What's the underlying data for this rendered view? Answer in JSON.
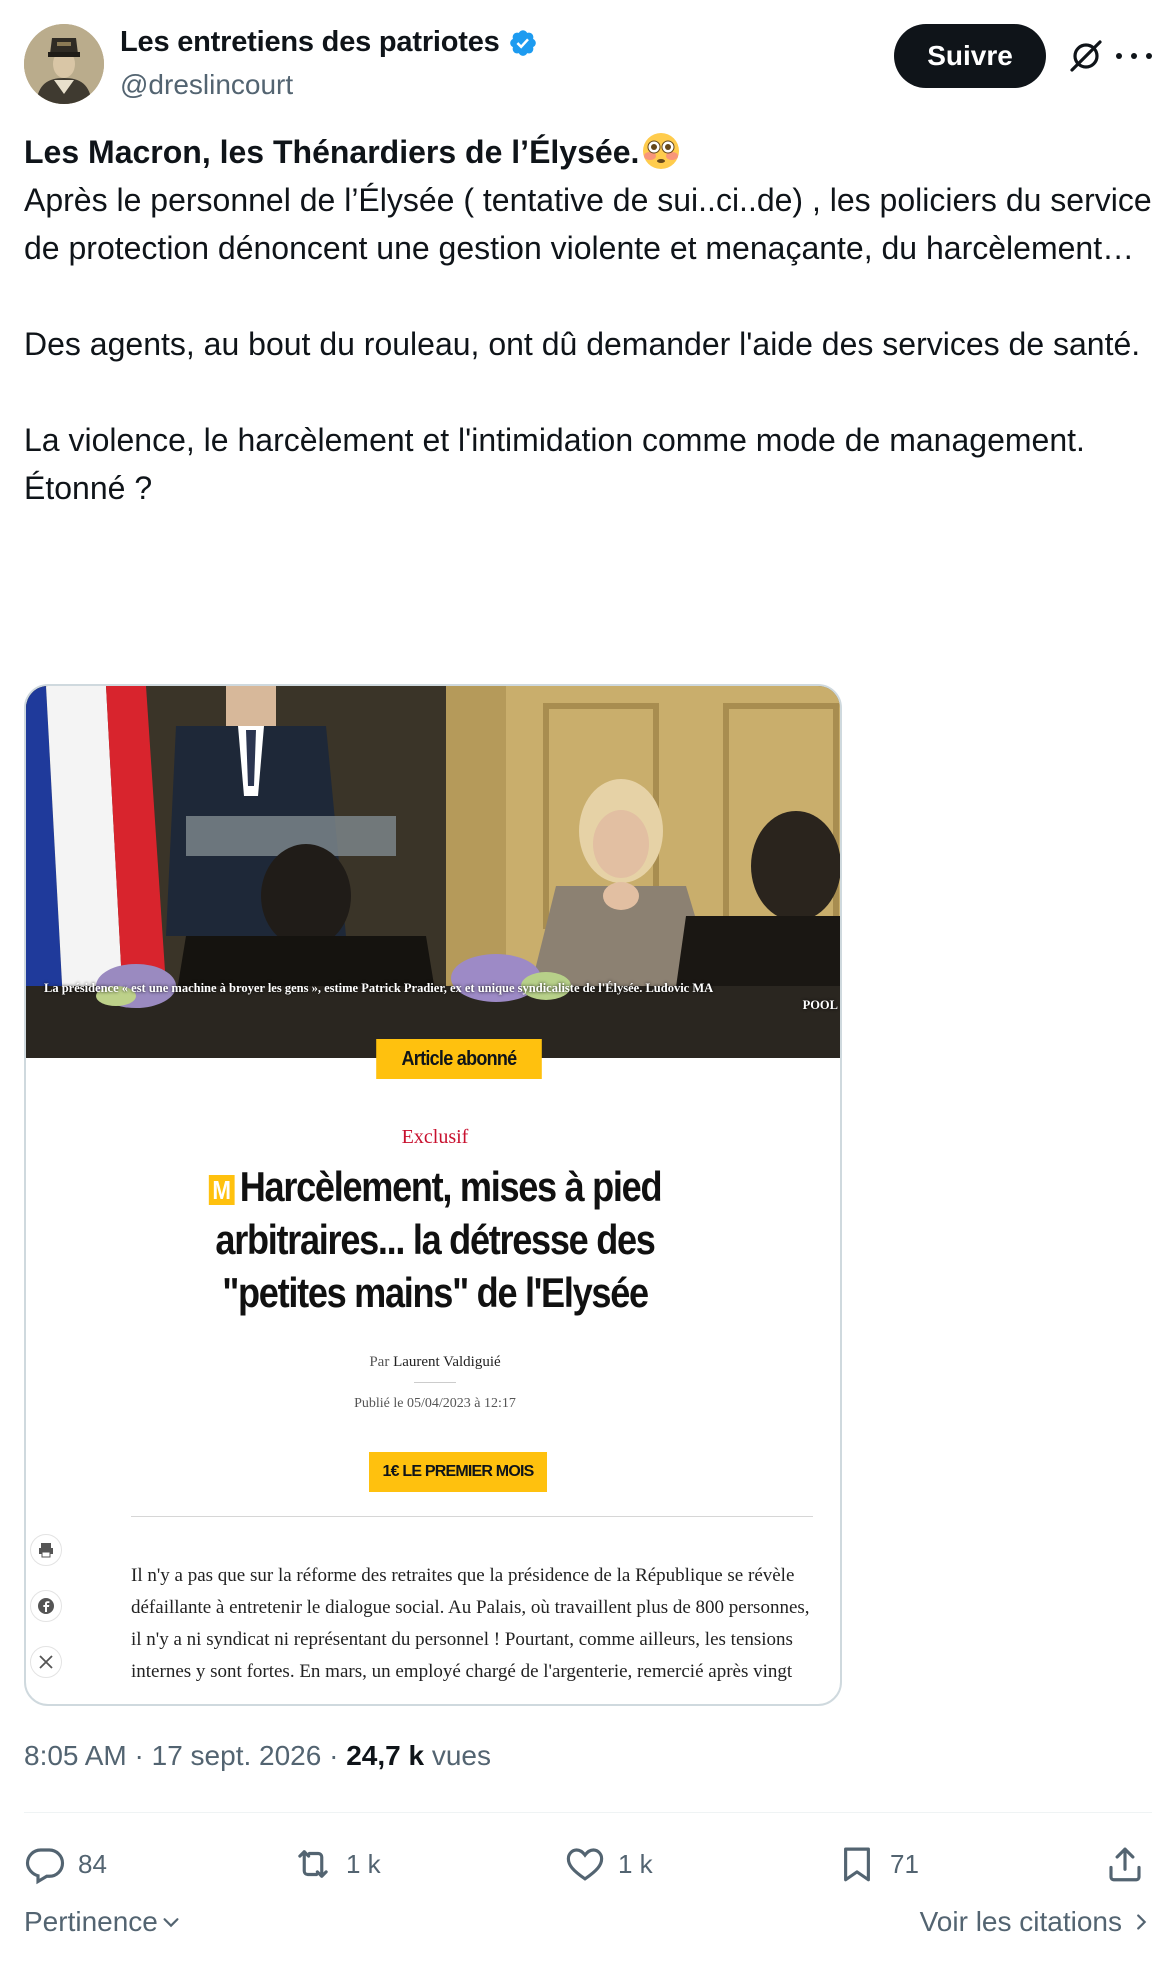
{
  "author": {
    "display_name": "Les entretiens des patriotes",
    "handle": "@dreslincourt",
    "verified_color": "#1d9bf0"
  },
  "header": {
    "follow_label": "Suivre"
  },
  "tweet": {
    "line1": "Les Macron, les Thénardiers de l’Élysée.",
    "line1_emoji": "flushed-face-emoji",
    "paragraph1": "Après le personnel de l’Élysée ( tentative de sui..ci..de) , les policiers du service de protection dénoncent une gestion violente et menaçante, du harcèlement…",
    "paragraph2": "Des agents, au bout du rouleau, ont dû demander l'aide des services de santé.",
    "paragraph3": "La violence, le harcèlement et l'intimidation comme mode de management.",
    "paragraph4": "Étonné ?"
  },
  "article_image": {
    "photo_caption_1": "La présidence « est une machine à broyer les gens », estime Patrick Pradier, ex et unique syndicaliste de l'Élysée. Ludovic MA",
    "photo_caption_2": "POOL",
    "badge": "Article abonné",
    "kicker": "Exclusif",
    "logo_letter": "M",
    "headline": "Harcèlement, mises à pied arbitraires... la détresse des \"petites mains\" de l'Elysée",
    "byline_prefix": "Par",
    "author": "Laurent Valdiguié",
    "published": "Publié le 05/04/2023 à 12:17",
    "cta": "1€ LE PREMIER MOIS",
    "body": "Il n'y a pas que sur la réforme des retraites que la présidence de la République se révèle défaillante à entretenir le dialogue social. Au Palais, où travaillent plus de 800 personnes, il n'y a ni syndicat ni représentant du personnel ! Pourtant, comme ailleurs, les tensions internes y sont fortes. En mars, un employé chargé de l'argenterie, remercié après vingt"
  },
  "meta": {
    "time": "8:05 AM",
    "separator": "·",
    "date": "17 sept. 2026",
    "views_count": "24,7 k",
    "views_label": "vues"
  },
  "actions": {
    "replies": "84",
    "reposts": "1 k",
    "likes": "1 k",
    "bookmarks": "71"
  },
  "footer": {
    "sort_label": "Pertinence",
    "quotes_label": "Voir les citations"
  }
}
